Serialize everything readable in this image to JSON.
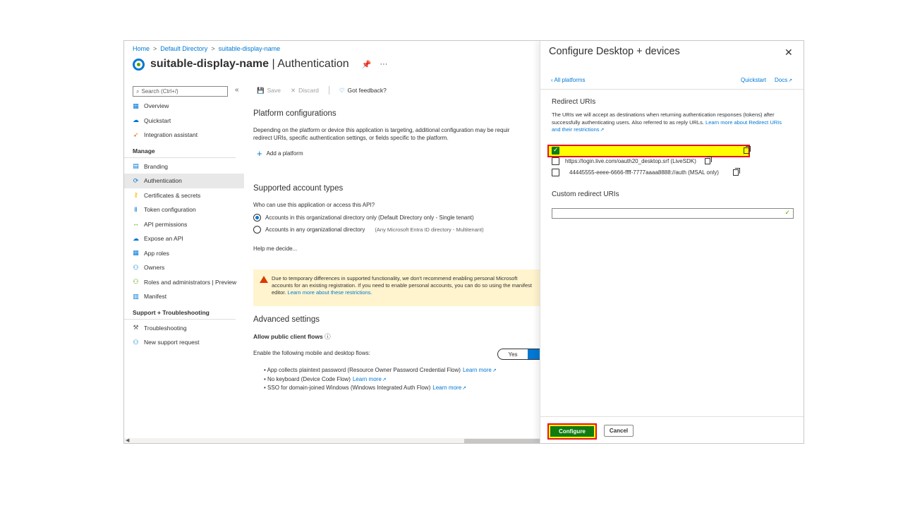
{
  "breadcrumb": [
    "Home",
    "Default Directory",
    "suitable-display-name"
  ],
  "breadcrumb_sep": ">",
  "page": {
    "app_name": "suitable-display-name",
    "section": "| Authentication",
    "pin_glyph": "📌",
    "more_glyph": "···"
  },
  "search": {
    "placeholder": "Search (Ctrl+/)",
    "collapse_glyph": "«"
  },
  "sidebar": {
    "top_items": [
      {
        "label": "Overview",
        "icon": "overview-icon",
        "glyph": "▦",
        "color": "#0078d4"
      },
      {
        "label": "Quickstart",
        "icon": "quickstart-icon",
        "glyph": "☁",
        "color": "#0078d4"
      },
      {
        "label": "Integration assistant",
        "icon": "rocket-icon",
        "glyph": "➶",
        "color": "#f7630c"
      }
    ],
    "manage_heading": "Manage",
    "manage_items": [
      {
        "label": "Branding",
        "icon": "branding-icon",
        "glyph": "▤",
        "color": "#0078d4"
      },
      {
        "label": "Authentication",
        "icon": "authentication-icon",
        "glyph": "⟳",
        "color": "#0078d4",
        "active": true
      },
      {
        "label": "Certificates & secrets",
        "icon": "key-icon",
        "glyph": "⚷",
        "color": "#ffb900"
      },
      {
        "label": "Token configuration",
        "icon": "token-icon",
        "glyph": "Ⅱ",
        "color": "#0078d4"
      },
      {
        "label": "API permissions",
        "icon": "permissions-icon",
        "glyph": "↔",
        "color": "#57a300"
      },
      {
        "label": "Expose an API",
        "icon": "cloud-icon",
        "glyph": "☁",
        "color": "#0078d4"
      },
      {
        "label": "App roles",
        "icon": "roles-icon",
        "glyph": "▦",
        "color": "#0078d4"
      },
      {
        "label": "Owners",
        "icon": "owners-icon",
        "glyph": "⚇",
        "color": "#0078d4"
      },
      {
        "label": "Roles and administrators | Preview",
        "icon": "admin-icon",
        "glyph": "⚇",
        "color": "#57a300"
      },
      {
        "label": "Manifest",
        "icon": "manifest-icon",
        "glyph": "▥",
        "color": "#0078d4"
      }
    ],
    "support_heading": "Support + Troubleshooting",
    "support_items": [
      {
        "label": "Troubleshooting",
        "icon": "wrench-icon",
        "glyph": "⚒",
        "color": "#605e5c"
      },
      {
        "label": "New support request",
        "icon": "support-icon",
        "glyph": "⚇",
        "color": "#0078d4"
      }
    ]
  },
  "toolbar": {
    "save": "Save",
    "discard": "Discard",
    "feedback": "Got feedback?",
    "save_glyph": "💾",
    "discard_glyph": "✕",
    "feedback_glyph": "♡"
  },
  "platform": {
    "title": "Platform configurations",
    "desc1": "Depending on the platform or device this application is targeting, additional configuration may be requir",
    "desc2": "redirect URIs, specific authentication settings, or fields specific to the platform.",
    "add": "Add a platform",
    "add_glyph": "+"
  },
  "accounts": {
    "title": "Supported account types",
    "question": "Who can use this application or access this API?",
    "option1": "Accounts in this organizational directory only (Default Directory only - Single tenant)",
    "option2": "Accounts in any organizational directory",
    "option2_note": "(Any Microsoft Entra ID directory - Multitenant)",
    "help": "Help me decide..."
  },
  "warning": {
    "line1": "Due to temporary differences in supported functionality, we don't recommend enabling personal Microsoft",
    "line2": "accounts for an existing registration. If you need to enable personal accounts, you can do so using the manifest",
    "line3": "editor.",
    "link": "Learn more about these restrictions."
  },
  "advanced": {
    "title": "Advanced settings",
    "public_flows": "Allow public client flows",
    "info_glyph": "ⓘ",
    "enable": "Enable the following mobile and desktop flows:",
    "toggle_yes": "Yes",
    "flows": [
      {
        "text": "App collects plaintext password (Resource Owner Password Credential Flow)",
        "link": "Learn more"
      },
      {
        "text": "No keyboard (Device Code Flow)",
        "link": "Learn more"
      },
      {
        "text": "SSO for domain-joined Windows (Windows Integrated Auth Flow)",
        "link": "Learn more"
      }
    ]
  },
  "panel": {
    "title": "Configure Desktop + devices",
    "close_glyph": "✕",
    "back": "‹ All platforms",
    "quickstart": "Quickstart",
    "docs": "Docs",
    "redirect_title": "Redirect URIs",
    "redirect_desc": "The URIs we will accept as destinations when returning authentication responses (tokens) after successfully authenticating users. Also referred to as reply URLs.",
    "redirect_link1": "Learn more about",
    "redirect_link2": "Redirect URIs and their restrictions",
    "uris": [
      {
        "text": "",
        "checked": true
      },
      {
        "text": "https://login.live.com/oauth20_desktop.srf (LiveSDK)",
        "checked": false
      },
      {
        "text": "44445555-eeee-6666-ffff-7777aaaa8888://auth (MSAL only)",
        "checked": false
      }
    ],
    "custom_title": "Custom redirect URIs",
    "custom_check": "✓",
    "configure": "Configure",
    "cancel": "Cancel"
  },
  "colors": {
    "accent": "#0078d4",
    "configure_green": "#107c10",
    "highlight": "#ffff00",
    "highlight_border": "#e81123",
    "warning_bg": "#fff4ce"
  }
}
